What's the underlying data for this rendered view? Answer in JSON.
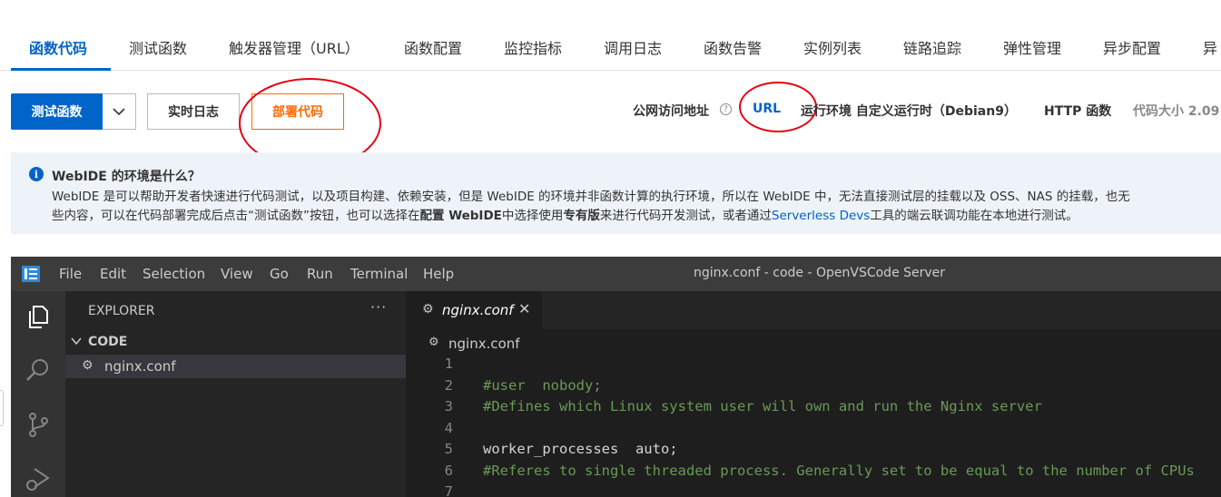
{
  "tabs": [
    {
      "label": "函数代码",
      "active": true
    },
    {
      "label": "测试函数"
    },
    {
      "label": "触发器管理（URL）"
    },
    {
      "label": "函数配置"
    },
    {
      "label": "监控指标"
    },
    {
      "label": "调用日志"
    },
    {
      "label": "函数告警"
    },
    {
      "label": "实例列表"
    },
    {
      "label": "链路追踪"
    },
    {
      "label": "弹性管理"
    },
    {
      "label": "异步配置"
    },
    {
      "label": "异"
    }
  ],
  "toolbar": {
    "test_button": "测试函数",
    "logs_button": "实时日志",
    "deploy_button": "部署代码"
  },
  "meta": {
    "public_url_label": "公网访问地址",
    "help_mark": "?",
    "url_link": "URL",
    "runtime": "运行环境 自定义运行时（Debian9）",
    "http_function": "HTTP 函数",
    "code_size": "代码大小 2.09"
  },
  "notice": {
    "icon_text": "i",
    "title": "WebIDE 的环境是什么？",
    "line1": "WebIDE 是可以帮助开发者快速进行代码测试，以及项目构建、依赖安装，但是 WebIDE 的环境并非函数计算的执行环境，所以在 WebIDE 中，无法直接测试层的挂载以及 OSS、NAS 的挂载，也无",
    "line2_a": "些内容，可以在代码部署完成后点击“测试函数”按钮，也可以选择在",
    "line2_b": "配置 WebIDE",
    "line2_c": "中选择使用",
    "line2_d": "专有版",
    "line2_e": "来进行代码开发测试，或者通过",
    "line2_link": "Serverless Devs",
    "line2_f": "工具的端云联调功能在本地进行测试。"
  },
  "vscode": {
    "menu": [
      "File",
      "Edit",
      "Selection",
      "View",
      "Go",
      "Run",
      "Terminal",
      "Help"
    ],
    "window_title": "nginx.conf - code - OpenVSCode Server",
    "explorer_title": "EXPLORER",
    "explorer_more": "···",
    "section_title": "CODE",
    "file_name": "nginx.conf",
    "tab_name": "nginx.conf",
    "tab_close": "✕",
    "breadcrumb": "nginx.conf",
    "code_lines": [
      {
        "n": "1",
        "text": "",
        "type": "plain"
      },
      {
        "n": "2",
        "text": "#user  nobody;",
        "type": "comment"
      },
      {
        "n": "3",
        "text": "#Defines which Linux system user will own and run the Nginx server",
        "type": "comment"
      },
      {
        "n": "4",
        "text": "",
        "type": "plain"
      },
      {
        "n": "5",
        "text": "worker_processes  auto;",
        "type": "plain"
      },
      {
        "n": "6",
        "text": "#Referes to single threaded process. Generally set to be equal to the number of CPUs",
        "type": "comment"
      },
      {
        "n": "7",
        "text": "",
        "type": "plain"
      }
    ]
  },
  "colors": {
    "primary": "#0064c8",
    "deploy": "#ff6a00",
    "annotation": "#e60012"
  }
}
